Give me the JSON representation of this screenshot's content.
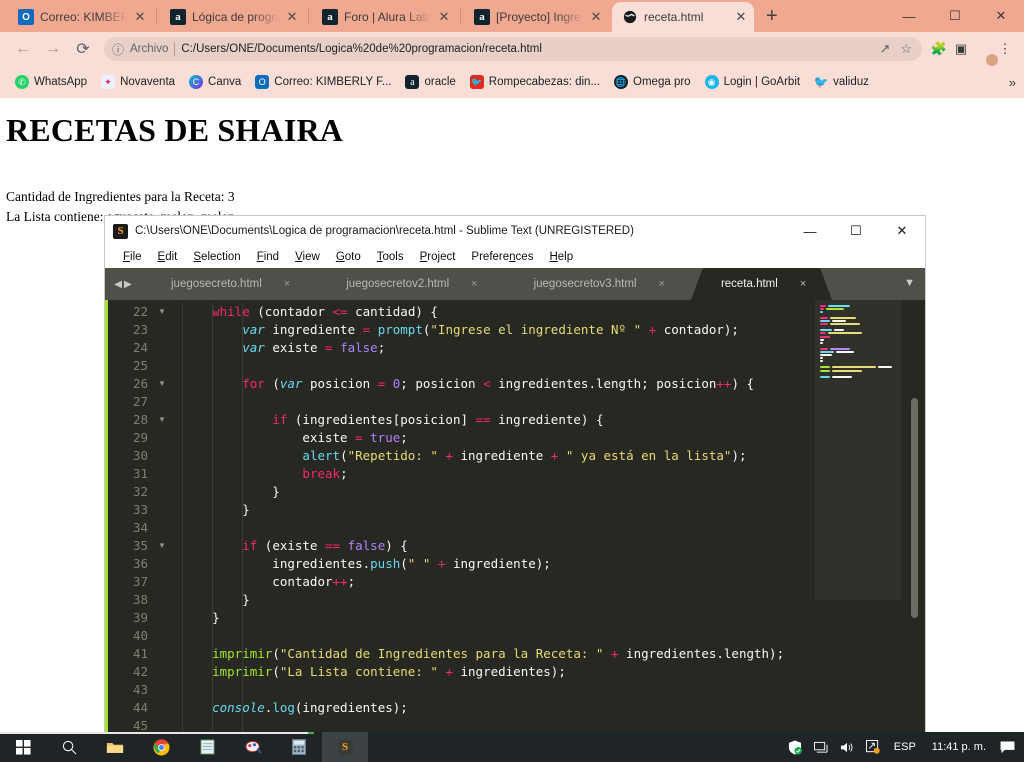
{
  "browser": {
    "tabs": [
      {
        "title": "Correo: KIMBERLY F...",
        "icon": "outlook-icon",
        "active": false
      },
      {
        "title": "Lógica de programa...",
        "icon": "alura-icon",
        "active": false
      },
      {
        "title": "Foro | Alura Latam",
        "icon": "alura-icon",
        "active": false
      },
      {
        "title": "[Proyecto] Ingresar...",
        "icon": "alura-icon",
        "active": false
      },
      {
        "title": "receta.html",
        "icon": "globe-icon",
        "active": true
      }
    ],
    "new_tab_label": "+",
    "window_controls": {
      "minimize": "—",
      "maximize": "☐",
      "close": "✕"
    },
    "nav": {
      "back": "←",
      "forward": "→",
      "reload": "⟳"
    },
    "omnibox": {
      "info_icon": "info-circle-icon",
      "scheme_label": "Archivo",
      "url": "C:/Users/ONE/Documents/Logica%20de%20programacion/receta.html",
      "share_icon": "share-icon",
      "bookmark_icon": "star-icon"
    },
    "toolbar_icons": {
      "extensions": "puzzle-icon",
      "sidepanel": "side-panel-icon",
      "menu": "three-dots-icon"
    },
    "bookmarks": [
      {
        "label": "WhatsApp",
        "icon": "whatsapp-icon",
        "color": "#25d366"
      },
      {
        "label": "Novaventa",
        "icon": "novaventa-icon",
        "color": "#e8e8ff"
      },
      {
        "label": "Canva",
        "icon": "canva-icon",
        "color": "#7d2ae8"
      },
      {
        "label": "Correo: KIMBERLY F...",
        "icon": "outlook-icon",
        "color": "#0f6cbd"
      },
      {
        "label": "oracle",
        "icon": "alura-icon",
        "color": "#10232e"
      },
      {
        "label": "Rompecabezas: din...",
        "icon": "puzzle-bird-icon",
        "color": "#e02b20"
      },
      {
        "label": "Omega pro",
        "icon": "globe-icon",
        "color": "#1a1a1a"
      },
      {
        "label": "Login | GoArbit",
        "icon": "goarbit-icon",
        "color": "#18b6e8"
      },
      {
        "label": "validuz",
        "icon": "validuz-icon",
        "color": "#d6b84a"
      }
    ],
    "bookmarks_overflow": "»"
  },
  "page": {
    "heading": "RECETAS DE SHAIRA",
    "line1": "Cantidad de Ingredientes para la Receta: 3",
    "line2": "La Lista contiene: aguacate, melon, melon"
  },
  "sublime": {
    "title": "C:\\Users\\ONE\\Documents\\Logica de programacion\\receta.html - Sublime Text (UNREGISTERED)",
    "logo": "S",
    "window_controls": {
      "minimize": "—",
      "maximize": "☐",
      "close": "✕"
    },
    "menu": [
      {
        "label": "File",
        "mnemonic": "F"
      },
      {
        "label": "Edit",
        "mnemonic": "E"
      },
      {
        "label": "Selection",
        "mnemonic": "S"
      },
      {
        "label": "Find",
        "mnemonic": "F"
      },
      {
        "label": "View",
        "mnemonic": "V"
      },
      {
        "label": "Goto",
        "mnemonic": "G"
      },
      {
        "label": "Tools",
        "mnemonic": "T"
      },
      {
        "label": "Project",
        "mnemonic": "P"
      },
      {
        "label": "Preferences",
        "mnemonic": "n"
      },
      {
        "label": "Help",
        "mnemonic": "H"
      }
    ],
    "tabs": [
      {
        "label": "juegosecreto.html",
        "active": false,
        "close": "×"
      },
      {
        "label": "juegosecretov2.html",
        "active": false,
        "close": "×"
      },
      {
        "label": "juegosecretov3.html",
        "active": false,
        "close": "×"
      },
      {
        "label": "receta.html",
        "active": true,
        "close": "×"
      }
    ],
    "tab_nav_left": "◀",
    "tab_nav_right": "▶",
    "tab_menu": "▼",
    "fold_marker": "▼",
    "code_lines": [
      {
        "num": 22,
        "fold": true,
        "text": "    while (contador <= cantidad) {"
      },
      {
        "num": 23,
        "fold": false,
        "text": "        var ingrediente = prompt(\"Ingrese el ingrediente Nº \" + contador);"
      },
      {
        "num": 24,
        "fold": false,
        "text": "        var existe = false;"
      },
      {
        "num": 25,
        "fold": false,
        "text": ""
      },
      {
        "num": 26,
        "fold": true,
        "text": "        for (var posicion = 0; posicion < ingredientes.length; posicion++) {"
      },
      {
        "num": 27,
        "fold": false,
        "text": ""
      },
      {
        "num": 28,
        "fold": true,
        "text": "            if (ingredientes[posicion] == ingrediente) {"
      },
      {
        "num": 29,
        "fold": false,
        "text": "                existe = true;"
      },
      {
        "num": 30,
        "fold": false,
        "text": "                alert(\"Repetido: \" + ingrediente + \" ya está en la lista\");"
      },
      {
        "num": 31,
        "fold": false,
        "text": "                break;"
      },
      {
        "num": 32,
        "fold": false,
        "text": "            }"
      },
      {
        "num": 33,
        "fold": false,
        "text": "        }"
      },
      {
        "num": 34,
        "fold": false,
        "text": ""
      },
      {
        "num": 35,
        "fold": true,
        "text": "        if (existe == false) {"
      },
      {
        "num": 36,
        "fold": false,
        "text": "            ingredientes.push(\" \" + ingrediente);"
      },
      {
        "num": 37,
        "fold": false,
        "text": "            contador++;"
      },
      {
        "num": 38,
        "fold": false,
        "text": "        }"
      },
      {
        "num": 39,
        "fold": false,
        "text": "    }"
      },
      {
        "num": 40,
        "fold": false,
        "text": ""
      },
      {
        "num": 41,
        "fold": false,
        "text": "    imprimir(\"Cantidad de Ingredientes para la Receta: \" + ingredientes.length);"
      },
      {
        "num": 42,
        "fold": false,
        "text": "    imprimir(\"La Lista contiene: \" + ingredientes);"
      },
      {
        "num": 43,
        "fold": false,
        "text": ""
      },
      {
        "num": 44,
        "fold": false,
        "text": "    console.log(ingredientes);"
      },
      {
        "num": 45,
        "fold": false,
        "text": ""
      }
    ],
    "colors": {
      "background": "#272822",
      "keyword": "#f92672",
      "storage": "#66d9ef",
      "function": "#a6e22e",
      "string": "#e6db74",
      "constant": "#ae81ff",
      "foreground": "#f8f8f2",
      "line_number": "#7d8070"
    }
  },
  "taskbar": {
    "start": "start-icon",
    "items": [
      {
        "name": "search-icon",
        "open": false
      },
      {
        "name": "file-explorer-icon",
        "open": false
      },
      {
        "name": "chrome-icon",
        "open": false
      },
      {
        "name": "notepad-icon",
        "open": false
      },
      {
        "name": "paint-icon",
        "open": false
      },
      {
        "name": "calculator-icon",
        "open": false
      },
      {
        "name": "sublime-text-icon",
        "open": true
      }
    ],
    "tray": {
      "security": "windows-security-icon",
      "network": "network-icon",
      "volume": "volume-icon",
      "onedrive": "onedrive-icon",
      "language": "ESP",
      "clock": "11:41 p. m.",
      "notifications": "notifications-icon"
    }
  }
}
